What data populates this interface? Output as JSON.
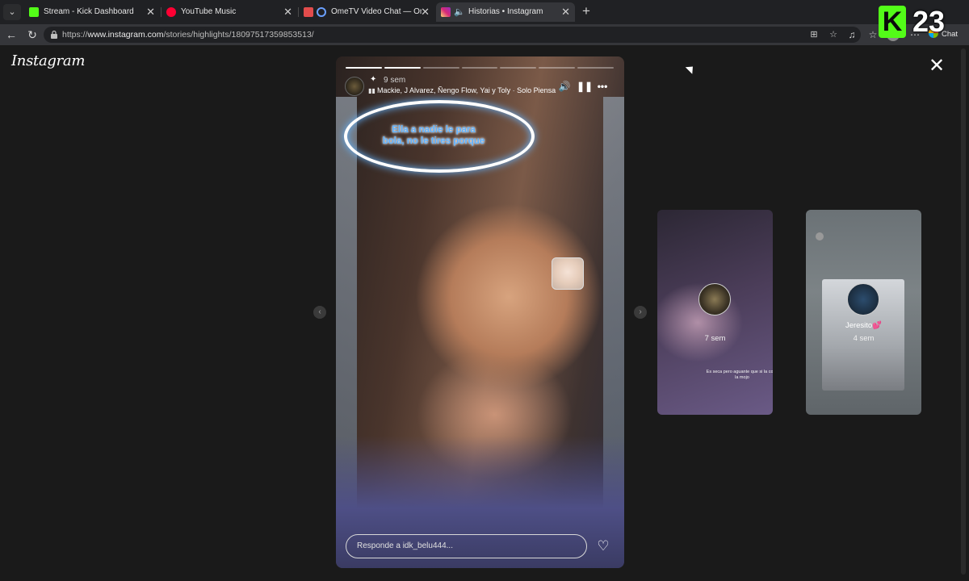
{
  "browser": {
    "menu_icon": "chevron-down-icon",
    "tabs": [
      {
        "title": "Stream - Kick Dashboard",
        "favicon_color": "#53fc18",
        "active": false
      },
      {
        "title": "YouTube Music",
        "favicon_color": "#ff0033",
        "active": false
      },
      {
        "title": "OmeTV Video Chat — Omegle",
        "favicon_color": "#e24c4c",
        "active": false
      },
      {
        "title": "Historias • Instagram",
        "favicon_color": "#d62976",
        "active": true
      }
    ],
    "close_glyph": "✕",
    "new_tab_glyph": "+",
    "url_prefix": "https://",
    "url_host": "www.instagram.com",
    "url_path": "/stories/highlights/18097517359853513/",
    "chat_label": "Chat"
  },
  "overlay": {
    "badge_letter": "K",
    "number": "23",
    "badge_color": "#53fc18"
  },
  "instagram": {
    "logo_text": "Instagram",
    "close_glyph": "✕",
    "story": {
      "segments_total": 7,
      "segments_viewed": 2,
      "time_ago": "9 sem",
      "song": "Mackie, J Alvarez, Ñengo Flow, Yai y Toly",
      "song_separator": "·",
      "song_title": "Solo Piensa",
      "caption": "Ella a nadie le para bola, no le tires porque",
      "reply_placeholder": "Responde a idk_belu444..."
    },
    "next_stories": [
      {
        "name": "",
        "time_ago": "7 sem",
        "caption": "Es seca pero aguante que si la cojo, la mojo"
      },
      {
        "name": "Jeresito",
        "name_badge": "💕",
        "time_ago": "4 sem"
      }
    ],
    "prev_arrow": "‹",
    "next_arrow": "›"
  }
}
